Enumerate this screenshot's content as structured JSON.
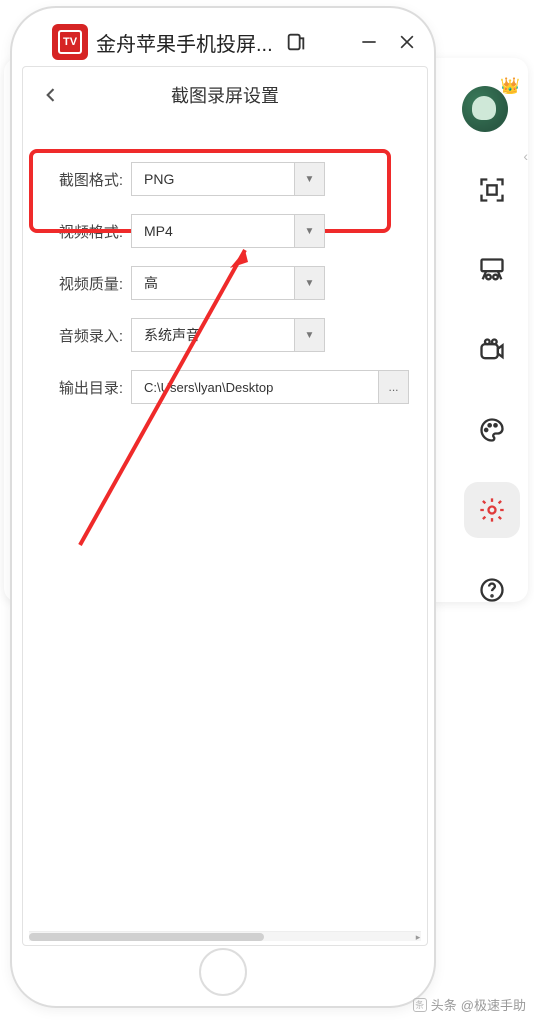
{
  "window": {
    "title": "金舟苹果手机投屏...",
    "app_icon_label": "TV"
  },
  "panel": {
    "title": "截图录屏设置"
  },
  "form": {
    "screenshot_format": {
      "label": "截图格式:",
      "value": "PNG"
    },
    "video_format": {
      "label": "视频格式:",
      "value": "MP4"
    },
    "video_quality": {
      "label": "视频质量:",
      "value": "高"
    },
    "audio_input": {
      "label": "音频录入:",
      "value": "系统声音"
    },
    "output_dir": {
      "label": "输出目录:",
      "value": "C:\\Users\\lyan\\Desktop",
      "browse": "..."
    }
  },
  "watermark": {
    "prefix": "头条",
    "account": "@极速手助"
  }
}
